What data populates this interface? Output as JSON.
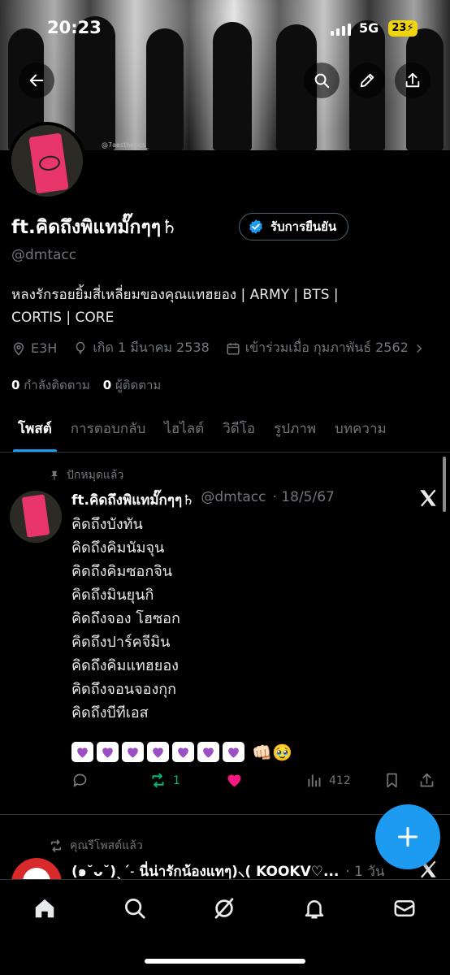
{
  "status_bar": {
    "time": "20:23",
    "network": "5G",
    "battery": "23"
  },
  "banner": {
    "credit": "@7aesthetics_"
  },
  "profile": {
    "name": "ft.คิดถึงพิแทมั๊กๆๆ♄",
    "verify_label": "รับการยืนยัน",
    "handle": "@dmtacc",
    "bio_line1": "หลงรักรอยยิ้มสี่เหลี่ยมของคุณแทฮยอง | ARMY | BTS |",
    "bio_line2": "CORTIS | CORE",
    "location": "E3H",
    "birthday": "เกิด 1 มีนาคม 2538",
    "joined": "เข้าร่วมเมื่อ กุมภาพันธ์ 2562",
    "following_count": "0",
    "following_label": "กำลังติดตาม",
    "followers_count": "0",
    "followers_label": "ผู้ติดตาม"
  },
  "tabs": [
    {
      "label": "โพสต์"
    },
    {
      "label": "การตอบกลับ"
    },
    {
      "label": "ไฮไลต์"
    },
    {
      "label": "วิดีโอ"
    },
    {
      "label": "รูปภาพ"
    },
    {
      "label": "บทความ"
    }
  ],
  "pinned_post": {
    "pinned_label": "ปักหมุดแล้ว",
    "name": "ft.คิดถึงพิแทมั๊กๆๆ♄",
    "handle": "@dmtacc",
    "date": "· 18/5/67",
    "lines": [
      "คิดถึงบังทัน",
      "คิดถึงคิมนัมจุน",
      "คิดถึงคิมซอกจิน",
      "คิดถึงมินยุนกิ",
      "คิดถึงจอง โฮซอก",
      "คิดถึงปาร์คจีมิน",
      "คิดถึงคิมแทฮยอง",
      "คิดถึงจอนจองกุก",
      "คิดถึงบีทีเอส"
    ],
    "emoji_extra": "👊🏻🥹",
    "retweet_count": "1",
    "views_count": "412",
    "heart_color": "#f91880",
    "retweet_color": "#00ba7c"
  },
  "second_post": {
    "reposted_label": "คุณรีโพสต์แล้ว",
    "name": "(๑˘ᴗ˘)ˎˊ˗ นี่น่ารักน้องแทๆ)⸜( KOOKV♡...",
    "time": "· 1 วัน"
  },
  "colors": {
    "accent": "#1d9bf0",
    "verified": "#1d9bf0"
  },
  "nav": [
    "home-icon",
    "search-icon",
    "grok-icon",
    "notifications-icon",
    "messages-icon"
  ]
}
